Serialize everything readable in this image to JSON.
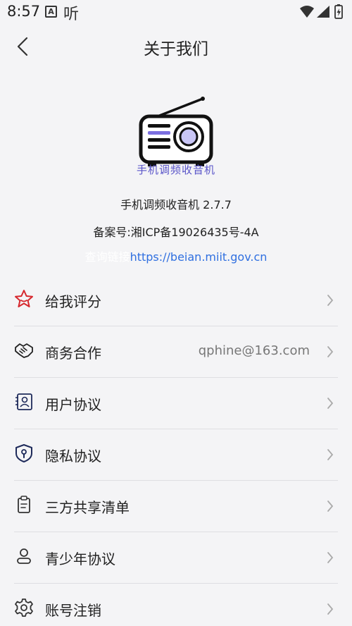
{
  "status_bar": {
    "time": "8:57",
    "app_icon_letter": "A",
    "app_icon_text": "听"
  },
  "header": {
    "title": "关于我们"
  },
  "about": {
    "logo_caption": "手机调频收音机",
    "app_name_version": "手机调频收音机  2.7.7",
    "icp": "备案号:湘ICP备19026435号-4A",
    "query_label": "查询链接",
    "query_url": "https://beian.miit.gov.cn"
  },
  "menu": {
    "items": [
      {
        "label": "给我评分",
        "value": "",
        "icon": "star-icon"
      },
      {
        "label": "商务合作",
        "value": "qphine@163.com",
        "icon": "handshake-icon"
      },
      {
        "label": "用户协议",
        "value": "",
        "icon": "user-contract-icon"
      },
      {
        "label": "隐私协议",
        "value": "",
        "icon": "shield-lock-icon"
      },
      {
        "label": "三方共享清单",
        "value": "",
        "icon": "clipboard-icon"
      },
      {
        "label": "青少年协议",
        "value": "",
        "icon": "teen-user-icon"
      },
      {
        "label": "账号注销",
        "value": "",
        "icon": "gear-icon"
      }
    ]
  },
  "colors": {
    "accent_red": "#d6282e",
    "accent_purple": "#5a55c9",
    "link_blue": "#2f6fe0",
    "shield_navy": "#1e2a5a"
  }
}
